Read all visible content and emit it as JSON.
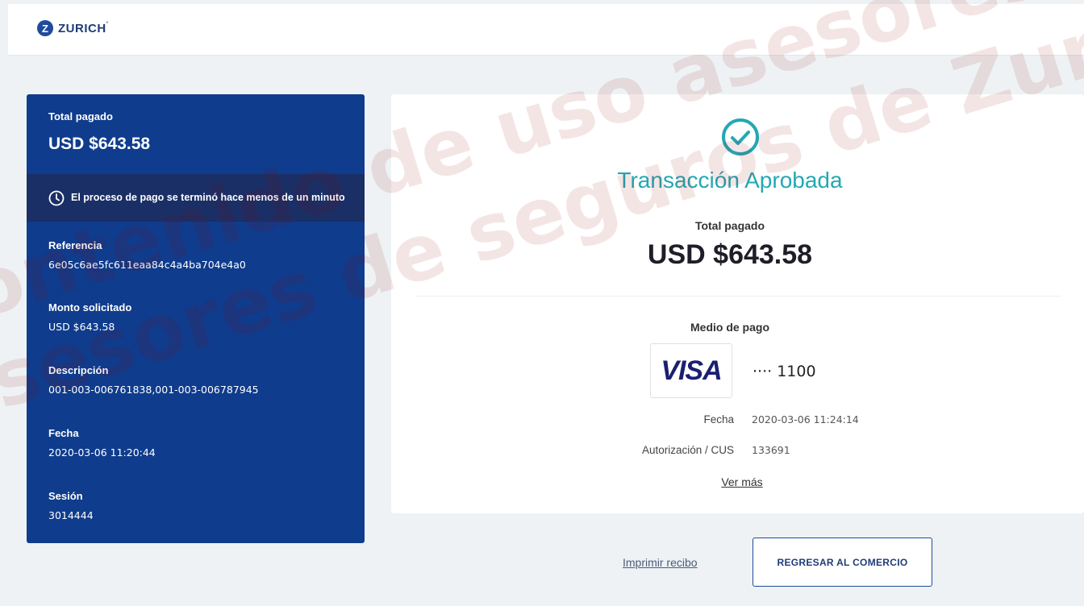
{
  "header": {
    "logo_letter": "Z",
    "logo_text": "ZURICH"
  },
  "summary": {
    "total_label": "Total pagado",
    "total_value": "USD $643.58",
    "notice": "El proceso de pago se terminó hace menos de un minuto",
    "fields": [
      {
        "label": "Referencia",
        "value": "6e05c6ae5fc611eaa84c4a4ba704e4a0"
      },
      {
        "label": "Monto solicitado",
        "value": "USD $643.58"
      },
      {
        "label": "Descripción",
        "value": "001-003-006761838,001-003-006787945"
      },
      {
        "label": "Fecha",
        "value": "2020-03-06 11:20:44"
      },
      {
        "label": "Sesión",
        "value": "3014444"
      }
    ]
  },
  "result": {
    "status_title": "Transacción Aprobada",
    "total_label": "Total pagado",
    "total_value": "USD $643.58",
    "payment_method_label": "Medio de pago",
    "card_brand": "VISA",
    "card_digits": "···· 1100",
    "date_label": "Fecha",
    "date_value": "2020-03-06 11:24:14",
    "auth_label": "Autorización / CUS",
    "auth_value": "133691",
    "more_link": "Ver más"
  },
  "actions": {
    "print_label": "Imprimir recibo",
    "return_label": "REGRESAR AL COMERCIO"
  },
  "watermark": {
    "line1": "Contenido de uso asesores",
    "line2": "asesores de seguros de Zurich"
  },
  "colors": {
    "panel": "#0f3c8c",
    "notice": "#1a2f66",
    "approved": "#23a8b4",
    "visa": "#1a1f71"
  }
}
